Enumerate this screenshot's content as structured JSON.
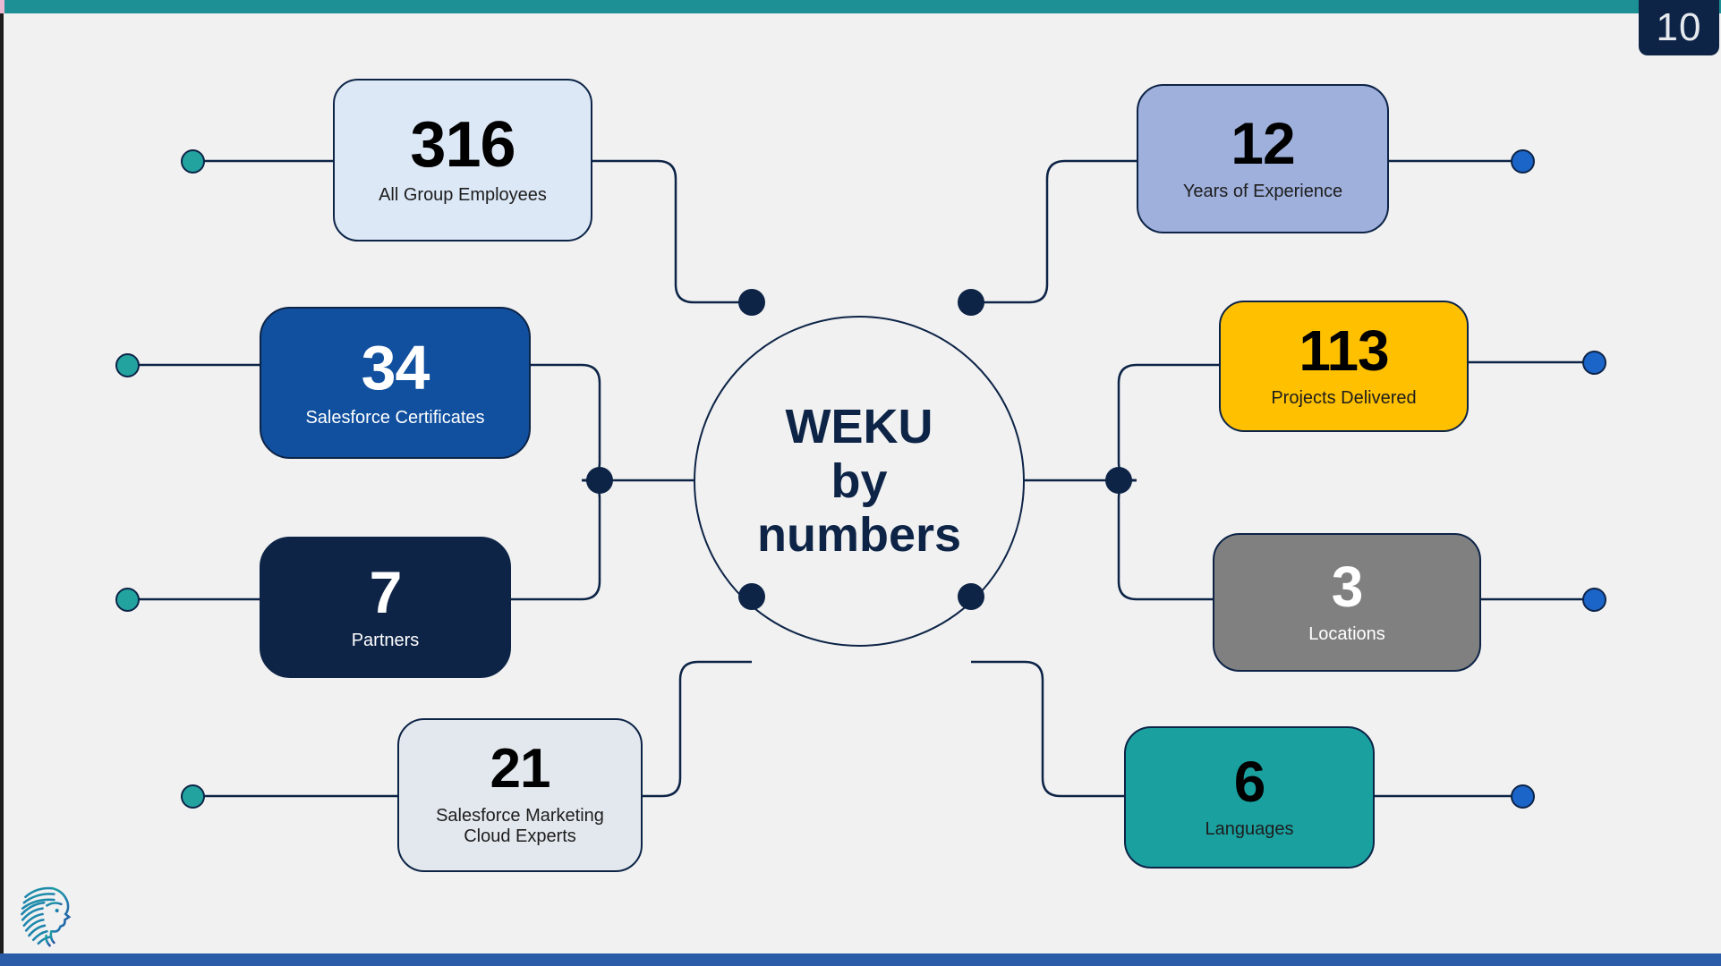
{
  "slide": {
    "page_number": "10",
    "hub_title": "WEKU\nby\nnumbers",
    "background_color": "#f1f1f1",
    "top_bar_color": "#1c9094",
    "bottom_bar_color": "#2a5ca8",
    "accent_navy": "#0d2447",
    "logo_name": "weku-head-profile-logo"
  },
  "left_stats": [
    {
      "value": "316",
      "label": "All Group Employees",
      "card_bg": "#dce8f6",
      "value_color": "#000000",
      "label_color": "#1d1d1d",
      "dot_color": "#23a3a0"
    },
    {
      "value": "34",
      "label": "Salesforce Certificates",
      "card_bg": "#11509f",
      "value_color": "#ffffff",
      "label_color": "#ffffff",
      "dot_color": "#23a3a0"
    },
    {
      "value": "7",
      "label": "Partners",
      "card_bg": "#0d2447",
      "value_color": "#ffffff",
      "label_color": "#ffffff",
      "dot_color": "#23a3a0"
    },
    {
      "value": "21",
      "label": "Salesforce Marketing Cloud Experts",
      "card_bg": "#e3e8ee",
      "value_color": "#000000",
      "label_color": "#1d1d1d",
      "dot_color": "#23a3a0"
    }
  ],
  "right_stats": [
    {
      "value": "12",
      "label": "Years of Experience",
      "card_bg": "#9fb0dc",
      "value_color": "#000000",
      "label_color": "#1d1d1d",
      "dot_color": "#1b64c8"
    },
    {
      "value": "113",
      "label": "Projects Delivered",
      "card_bg": "#ffc000",
      "value_color": "#000000",
      "label_color": "#1d1d1d",
      "dot_color": "#1b64c8"
    },
    {
      "value": "3",
      "label": "Locations",
      "card_bg": "#808080",
      "value_color": "#ffffff",
      "label_color": "#ffffff",
      "dot_color": "#1b64c8"
    },
    {
      "value": "6",
      "label": "Languages",
      "card_bg": "#1ba0a0",
      "value_color": "#000000",
      "label_color": "#1d1d1d",
      "dot_color": "#1b64c8"
    }
  ]
}
